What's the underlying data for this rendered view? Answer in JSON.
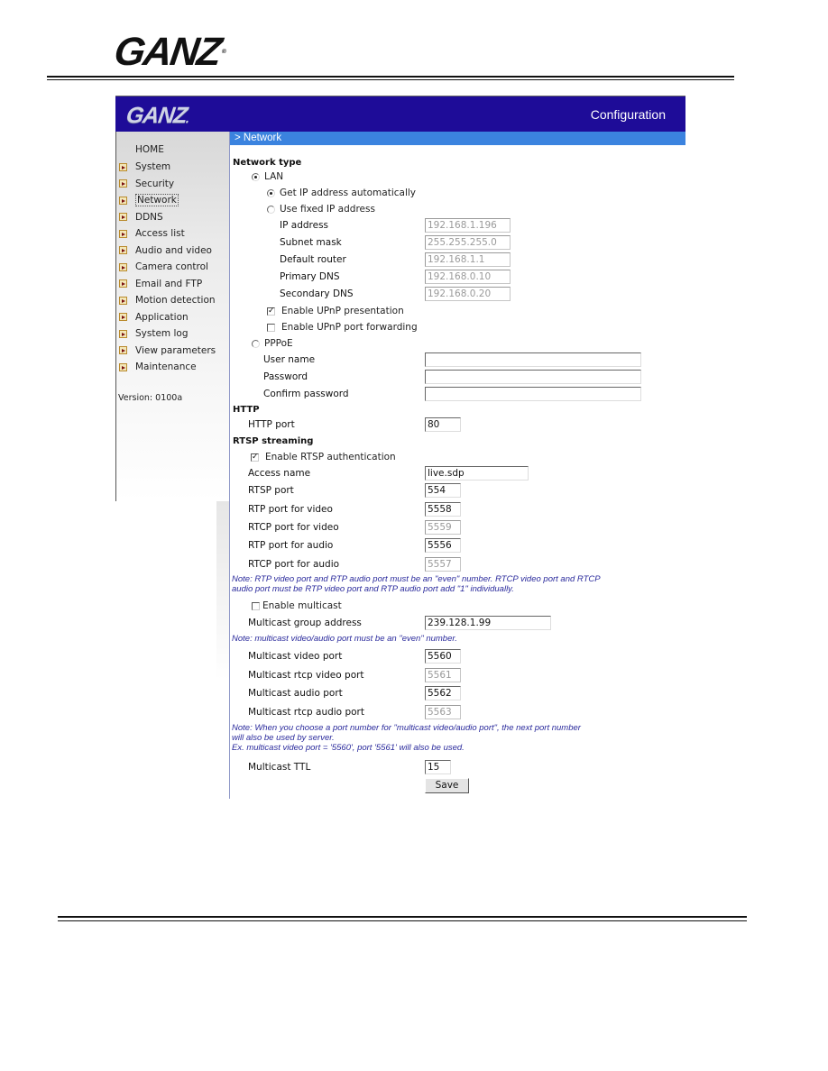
{
  "page": {
    "logo": "GANZ",
    "logo_mark": "®"
  },
  "app": {
    "logo": "GANZ",
    "title": "Configuration",
    "breadcrumb": "> Network",
    "version": "Version: 0100a",
    "colors": {
      "header": "#1e0c98",
      "breadcrumb_bar": "#3b83df",
      "note_text": "#2a2a9c"
    }
  },
  "sidebar": {
    "home": "HOME",
    "items": [
      {
        "label": "System"
      },
      {
        "label": "Security"
      },
      {
        "label": "Network",
        "active": true
      },
      {
        "label": "DDNS"
      },
      {
        "label": "Access list"
      },
      {
        "label": "Audio and video"
      },
      {
        "label": "Camera control"
      },
      {
        "label": "Email and FTP"
      },
      {
        "label": "Motion detection"
      },
      {
        "label": "Application"
      },
      {
        "label": "System log"
      },
      {
        "label": "View parameters"
      },
      {
        "label": "Maintenance"
      }
    ]
  },
  "network_type": {
    "heading": "Network type",
    "lan": {
      "label": "LAN",
      "selected": true
    },
    "auto_ip": {
      "label": "Get IP address automatically",
      "selected": true
    },
    "fixed_ip": {
      "label": "Use fixed IP address",
      "selected": false
    },
    "fields": [
      {
        "label": "IP address",
        "value": "192.168.1.196"
      },
      {
        "label": "Subnet mask",
        "value": "255.255.255.0"
      },
      {
        "label": "Default router",
        "value": "192.168.1.1"
      },
      {
        "label": "Primary DNS",
        "value": "192.168.0.10"
      },
      {
        "label": "Secondary DNS",
        "value": "192.168.0.20"
      }
    ],
    "upnp_presentation": {
      "label": "Enable UPnP presentation",
      "checked": true
    },
    "upnp_port_forwarding": {
      "label": "Enable UPnP port forwarding",
      "checked": false
    },
    "pppoe": {
      "label": "PPPoE",
      "selected": false
    },
    "pppoe_fields": [
      {
        "label": "User name",
        "value": ""
      },
      {
        "label": "Password",
        "value": ""
      },
      {
        "label": "Confirm password",
        "value": ""
      }
    ]
  },
  "http": {
    "heading": "HTTP",
    "port_label": "HTTP port",
    "port_value": "80"
  },
  "rtsp": {
    "heading": "RTSP streaming",
    "auth": {
      "label": "Enable RTSP authentication",
      "checked": true
    },
    "access_name_label": "Access name",
    "access_name_value": "live.sdp",
    "ports": [
      {
        "label": "RTSP port",
        "value": "554",
        "disabled": false
      },
      {
        "label": "RTP port for video",
        "value": "5558",
        "disabled": false
      },
      {
        "label": "RTCP port for video",
        "value": "5559",
        "disabled": true
      },
      {
        "label": "RTP port for audio",
        "value": "5556",
        "disabled": false
      },
      {
        "label": "RTCP port for audio",
        "value": "5557",
        "disabled": true
      }
    ],
    "note1_line1": "Note: RTP video port and RTP audio port must be an \"even\" number. RTCP video port and RTCP",
    "note1_line2": "audio port must be RTP video port and RTP audio port add \"1\" individually.",
    "multicast": {
      "label": "Enable multicast",
      "checked": false
    },
    "group_address_label": "Multicast group address",
    "group_address_value": "239.128.1.99",
    "note2": "Note: multicast video/audio port must be an \"even\" number.",
    "multicast_ports": [
      {
        "label": "Multicast video port",
        "value": "5560",
        "disabled": false
      },
      {
        "label": "Multicast rtcp video port",
        "value": "5561",
        "disabled": true
      },
      {
        "label": "Multicast audio port",
        "value": "5562",
        "disabled": false
      },
      {
        "label": "Multicast rtcp audio port",
        "value": "5563",
        "disabled": true
      }
    ],
    "note3_line1": "Note: When you choose a port number for \"multicast video/audio port\", the next port number",
    "note3_line2": "will also be used by server.",
    "note3_line3": "Ex. multicast video port = '5560', port '5561' will also be used.",
    "ttl_label": "Multicast TTL",
    "ttl_value": "15"
  },
  "actions": {
    "save": "Save"
  }
}
